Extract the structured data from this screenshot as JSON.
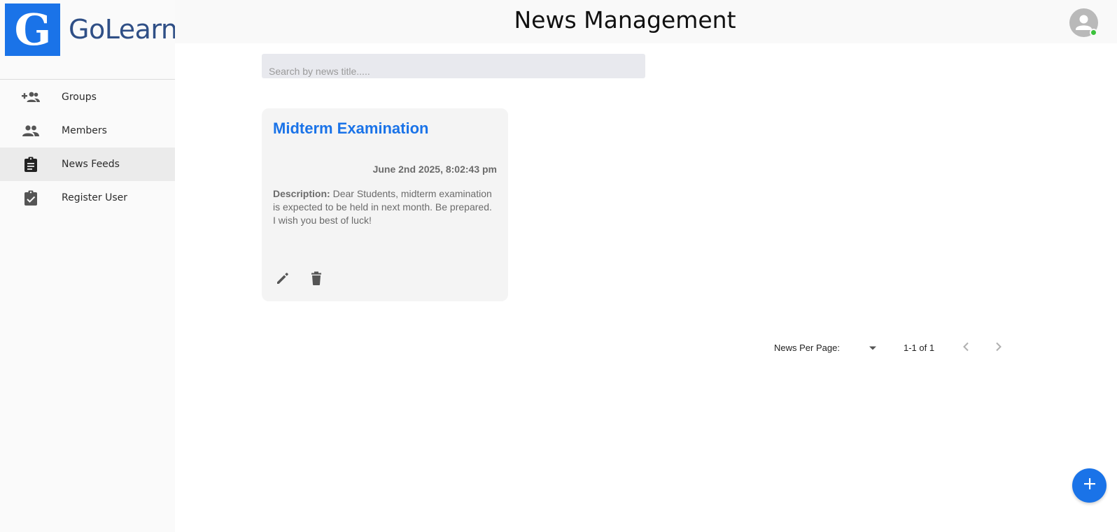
{
  "brand": {
    "name": "GoLearn",
    "logo_letter": "G",
    "color": "#1a73e8"
  },
  "header": {
    "title": "News Management",
    "avatar_icon": "user-avatar-icon",
    "status_color": "#3cc23c"
  },
  "sidebar": {
    "items": [
      {
        "label": "Groups",
        "icon": "group-add-icon",
        "active": false
      },
      {
        "label": "Members",
        "icon": "people-icon",
        "active": false
      },
      {
        "label": "News Feeds",
        "icon": "assignment-icon",
        "active": true
      },
      {
        "label": "Register User",
        "icon": "assignment-turned-in-icon",
        "active": false
      }
    ]
  },
  "search": {
    "placeholder": "Search by news title.....",
    "value": ""
  },
  "news": [
    {
      "title": "Midterm Examination",
      "date": "June 2nd 2025, 8:02:43 pm",
      "description_label": "Description:",
      "description": "Dear Students, midterm examination is expected to be held in next month. Be prepared. I wish you best of luck!",
      "actions": [
        "edit-icon",
        "delete-icon"
      ]
    }
  ],
  "pagination": {
    "per_page_label": "News Per Page:",
    "per_page_value": "",
    "range": "1-1 of 1",
    "prev_icon": "chevron-left-icon",
    "next_icon": "chevron-right-icon"
  },
  "fab": {
    "icon": "plus-icon",
    "color": "#1a73e8"
  }
}
